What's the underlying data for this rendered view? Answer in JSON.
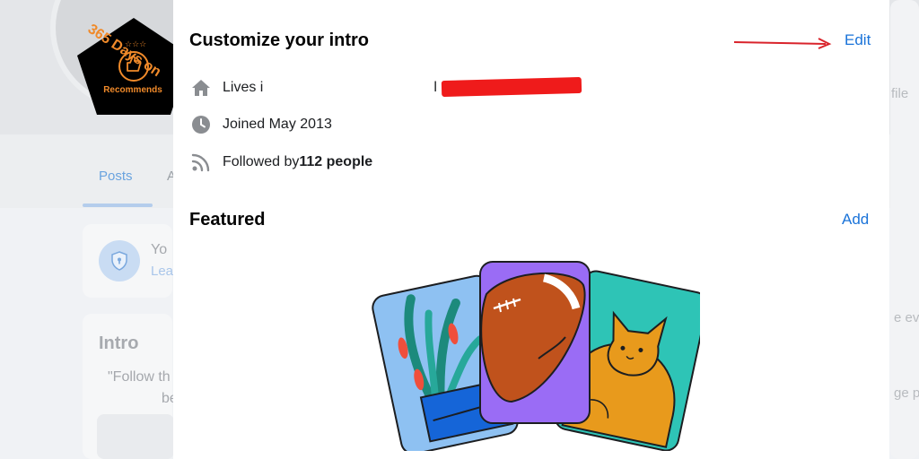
{
  "badge": {
    "title": "365 Days on",
    "subtitle": "Recommends"
  },
  "background": {
    "tabs": [
      "Posts",
      "A"
    ],
    "notice_title": "Yo",
    "notice_link": "Lea",
    "intro_title": "Intro",
    "intro_quote": "\"Follow th",
    "intro_quote_2": "be",
    "right_texts": [
      "file",
      "e eve",
      "ge p"
    ]
  },
  "intro": {
    "title": "Customize your intro",
    "edit_label": "Edit",
    "items": [
      {
        "icon": "home-icon",
        "prefix": "Lives i",
        "value": "l"
      },
      {
        "icon": "clock-icon",
        "text": "Joined May 2013"
      },
      {
        "icon": "rss-icon",
        "prefix": "Followed by ",
        "bold": "112 people"
      }
    ]
  },
  "featured": {
    "title": "Featured",
    "add_label": "Add"
  },
  "colors": {
    "accent": "#1a73d9",
    "icon_gray": "#8a8d91",
    "redaction": "#ef1b1b",
    "annotation_arrow": "#d9232b",
    "badge_orange": "#f08a2a"
  }
}
